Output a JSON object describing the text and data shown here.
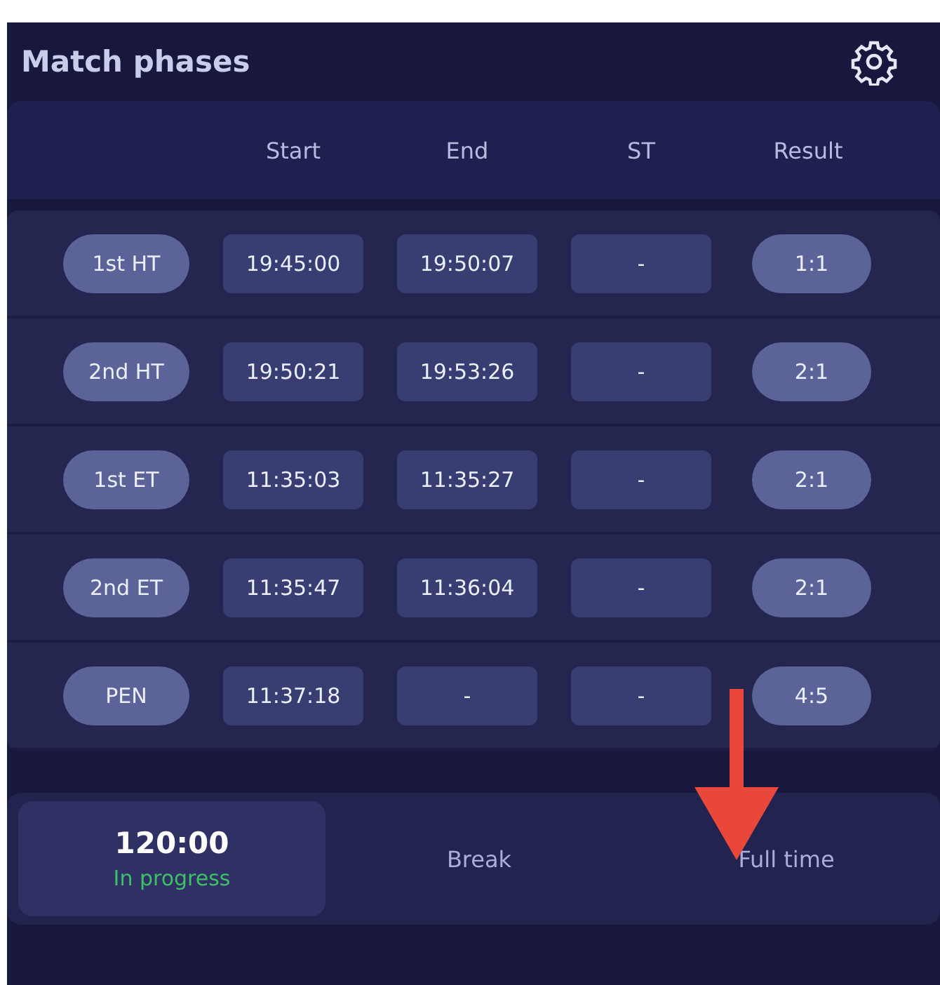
{
  "title": "Match phases",
  "columns": [
    "Start",
    "End",
    "ST",
    "Result"
  ],
  "rows": [
    {
      "phase": "1st HT",
      "start": "19:45:00",
      "end": "19:50:07",
      "st": "-",
      "result": "1:1"
    },
    {
      "phase": "2nd HT",
      "start": "19:50:21",
      "end": "19:53:26",
      "st": "-",
      "result": "2:1"
    },
    {
      "phase": "1st ET",
      "start": "11:35:03",
      "end": "11:35:27",
      "st": "-",
      "result": "2:1"
    },
    {
      "phase": "2nd ET",
      "start": "11:35:47",
      "end": "11:36:04",
      "st": "-",
      "result": "2:1"
    },
    {
      "phase": "PEN",
      "start": "11:37:18",
      "end": "-",
      "st": "-",
      "result": "4:5"
    }
  ],
  "segments": [
    {
      "kind": "timer",
      "time": "120:00",
      "status": "In progress",
      "selected": true
    },
    {
      "kind": "label",
      "label": "Break",
      "selected": false
    },
    {
      "kind": "label",
      "label": "Full time",
      "selected": false
    }
  ]
}
